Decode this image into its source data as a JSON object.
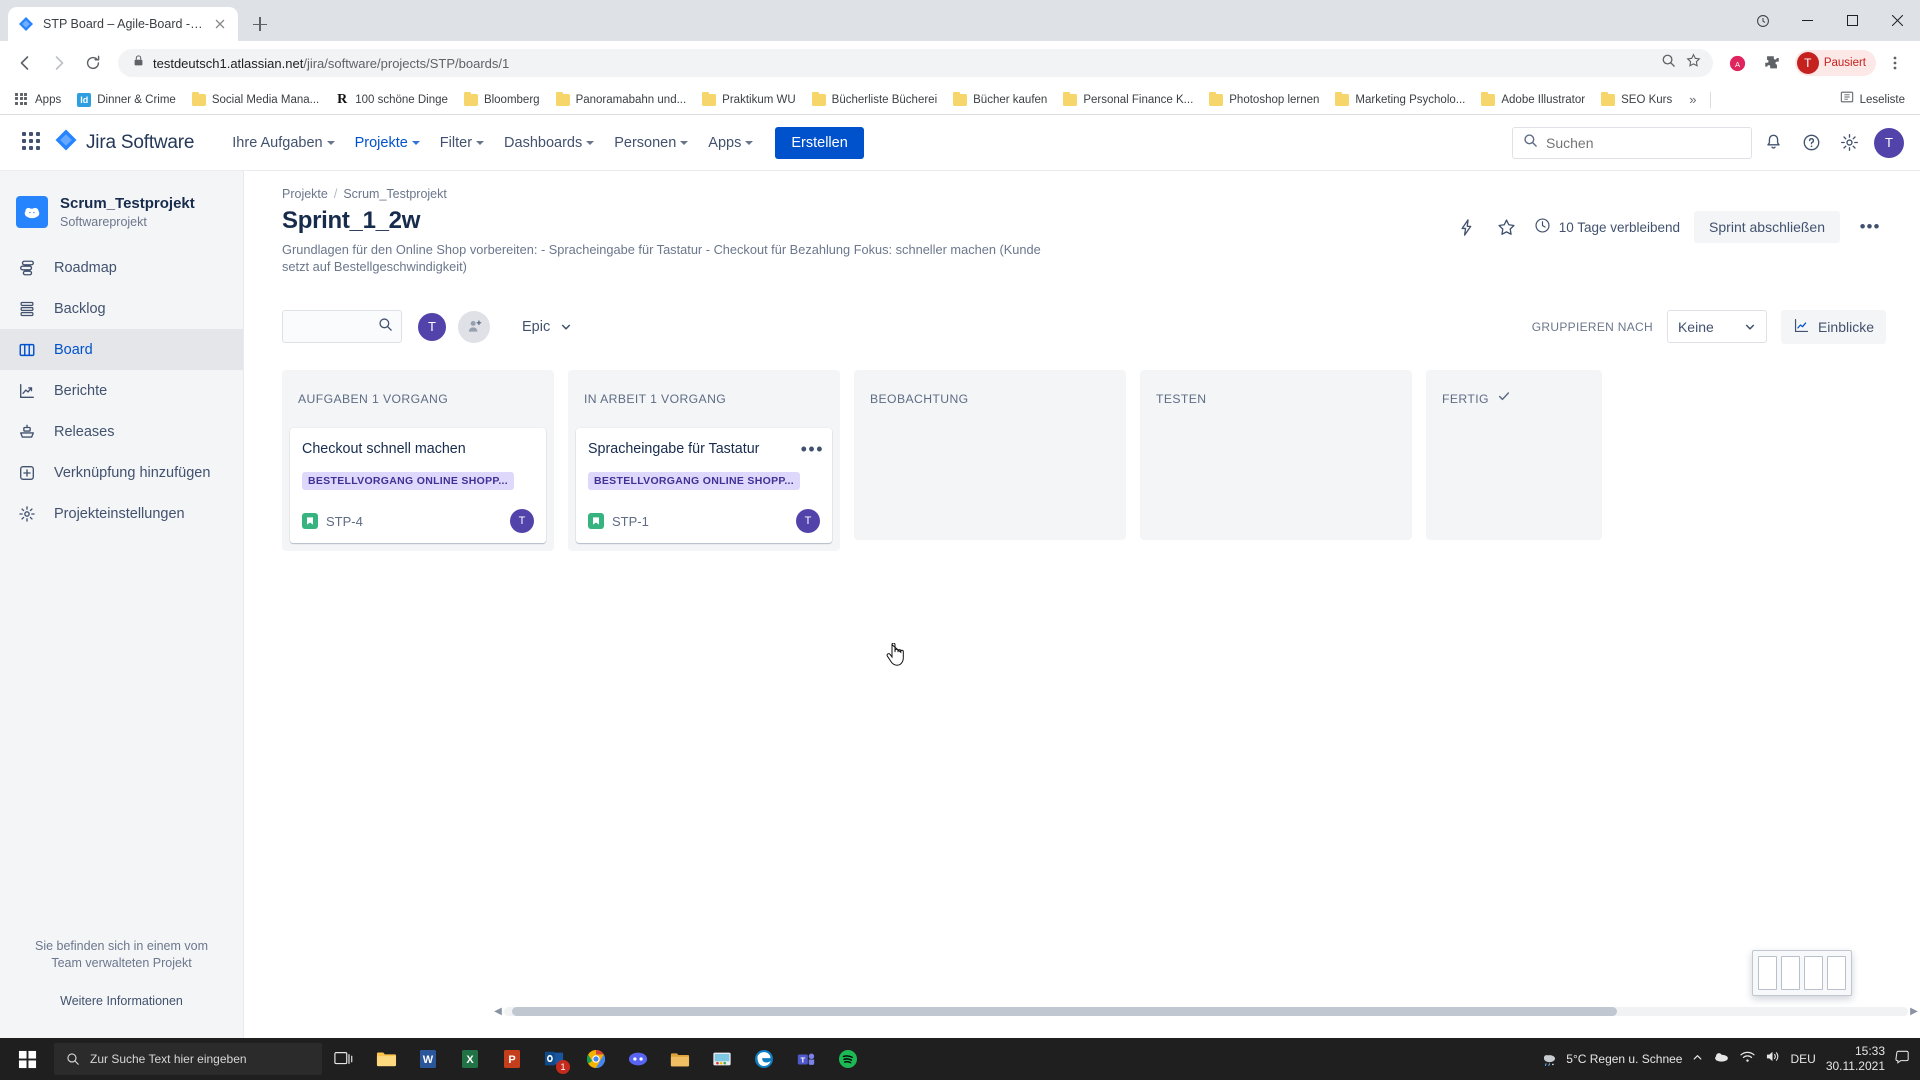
{
  "browser": {
    "tab": {
      "title": "STP Board – Agile-Board - Jira",
      "favicon": "jira-favicon"
    },
    "newtab_label": "+",
    "url_domain": "testdeutsch1.atlassian.net",
    "url_path": "/jira/software/projects/STP/boards/1",
    "profile_label": "Pausiert",
    "profile_initial": "T",
    "bookmarks": [
      {
        "label": "Apps",
        "icon": "apps-grid-icon"
      },
      {
        "label": "Dinner & Crime",
        "icon": "id-icon"
      },
      {
        "label": "Social Media Mana...",
        "icon": "folder-icon"
      },
      {
        "label": "100 schöne Dinge",
        "icon": "r-serif-icon"
      },
      {
        "label": "Bloomberg",
        "icon": "folder-icon"
      },
      {
        "label": "Panoramabahn und...",
        "icon": "folder-icon"
      },
      {
        "label": "Praktikum WU",
        "icon": "folder-icon"
      },
      {
        "label": "Bücherliste Bücherei",
        "icon": "folder-icon"
      },
      {
        "label": "Bücher kaufen",
        "icon": "folder-icon"
      },
      {
        "label": "Personal Finance K...",
        "icon": "folder-icon"
      },
      {
        "label": "Photoshop lernen",
        "icon": "folder-icon"
      },
      {
        "label": "Marketing Psycholo...",
        "icon": "folder-icon"
      },
      {
        "label": "Adobe Illustrator",
        "icon": "folder-icon"
      },
      {
        "label": "SEO Kurs",
        "icon": "folder-icon"
      }
    ],
    "bookmarks_overflow": "»",
    "reading_list": "Leseliste"
  },
  "jira_nav": {
    "product_name": "Jira Software",
    "items": [
      {
        "label": "Ihre Aufgaben",
        "active": false
      },
      {
        "label": "Projekte",
        "active": true
      },
      {
        "label": "Filter",
        "active": false
      },
      {
        "label": "Dashboards",
        "active": false
      },
      {
        "label": "Personen",
        "active": false
      },
      {
        "label": "Apps",
        "active": false
      }
    ],
    "create_label": "Erstellen",
    "search_placeholder": "Suchen",
    "avatar_initial": "T"
  },
  "sidebar": {
    "project_name": "Scrum_Testprojekt",
    "project_type": "Softwareprojekt",
    "items": [
      {
        "label": "Roadmap",
        "icon": "roadmap-icon",
        "active": false
      },
      {
        "label": "Backlog",
        "icon": "backlog-icon",
        "active": false
      },
      {
        "label": "Board",
        "icon": "board-icon",
        "active": true
      },
      {
        "label": "Berichte",
        "icon": "reports-icon",
        "active": false
      },
      {
        "label": "Releases",
        "icon": "releases-icon",
        "active": false
      },
      {
        "label": "Verknüpfung hinzufügen",
        "icon": "link-add-icon",
        "active": false
      },
      {
        "label": "Projekteinstellungen",
        "icon": "settings-icon",
        "active": false
      }
    ],
    "footer_text": "Sie befinden sich in einem vom Team verwalteten Projekt",
    "footer_link": "Weitere Informationen"
  },
  "header": {
    "breadcrumb_root": "Projekte",
    "breadcrumb_sep": "/",
    "breadcrumb_current": "Scrum_Testprojekt",
    "sprint_title": "Sprint_1_2w",
    "sprint_description": "Grundlagen für den Online Shop vorbereiten: - Spracheingabe für Tastatur - Checkout für Bezahlung Fokus: schneller machen (Kunde setzt auf Bestellgeschwindigkeit)",
    "time_remaining": "10 Tage verbleibend",
    "complete_sprint_label": "Sprint abschließen",
    "more_label": "•••"
  },
  "toolbar": {
    "search_placeholder": "",
    "search_value": "",
    "avatar_initial": "T",
    "epic_label": "Epic",
    "group_by_label": "GRUPPIEREN NACH",
    "group_by_value": "Keine",
    "insights_label": "Einblicke"
  },
  "board": {
    "columns": [
      {
        "title": "AUFGABEN 1 VORGANG",
        "narrow": false,
        "done_check": false,
        "cards": [
          {
            "title": "Checkout schnell machen",
            "epic": "BESTELLVORGANG ONLINE SHOPP...",
            "key": "STP-4",
            "avatar_initial": "T",
            "show_dots": false
          }
        ]
      },
      {
        "title": "IN ARBEIT 1 VORGANG",
        "narrow": false,
        "done_check": false,
        "cards": [
          {
            "title": "Spracheingabe für Tastatur",
            "epic": "BESTELLVORGANG ONLINE SHOPP...",
            "key": "STP-1",
            "avatar_initial": "T",
            "show_dots": true
          }
        ]
      },
      {
        "title": "BEOBACHTUNG",
        "narrow": false,
        "done_check": false,
        "cards": []
      },
      {
        "title": "TESTEN",
        "narrow": false,
        "done_check": false,
        "cards": []
      },
      {
        "title": "FERTIG",
        "narrow": true,
        "done_check": true,
        "cards": []
      }
    ]
  },
  "taskbar": {
    "search_placeholder": "Zur Suche Text hier eingeben",
    "weather": "5°C  Regen u. Schnee",
    "language": "DEU",
    "time": "15:33",
    "date": "30.11.2021",
    "mail_badge": "1",
    "apps": [
      "task-view-icon",
      "file-explorer-icon",
      "word-icon",
      "excel-icon",
      "powerpoint-icon",
      "outlook-icon",
      "chrome-icon",
      "discord-icon",
      "folder-icon",
      "paint-icon",
      "edge-icon",
      "teams-icon",
      "spotify-icon"
    ]
  },
  "colors": {
    "jira_blue": "#0052cc",
    "accent_purple": "#5243aa",
    "epic_bg": "#dfd8fd",
    "epic_fg": "#403294",
    "story_green": "#36b37e",
    "sidebar_bg": "#f4f5f7"
  }
}
